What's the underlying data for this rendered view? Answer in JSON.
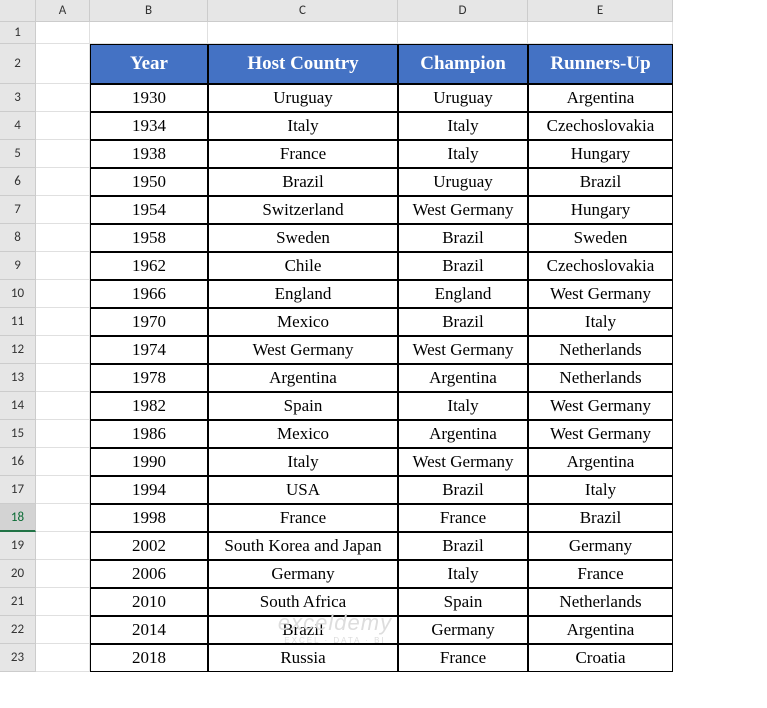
{
  "columns": [
    "A",
    "B",
    "C",
    "D",
    "E"
  ],
  "rowCount": 23,
  "selectedRow": 18,
  "headers": {
    "year": "Year",
    "host": "Host Country",
    "champion": "Champion",
    "runnersup": "Runners-Up"
  },
  "rows": [
    {
      "year": "1930",
      "host": "Uruguay",
      "champion": "Uruguay",
      "runnersup": "Argentina"
    },
    {
      "year": "1934",
      "host": "Italy",
      "champion": "Italy",
      "runnersup": "Czechoslovakia"
    },
    {
      "year": "1938",
      "host": "France",
      "champion": "Italy",
      "runnersup": "Hungary"
    },
    {
      "year": "1950",
      "host": "Brazil",
      "champion": "Uruguay",
      "runnersup": "Brazil"
    },
    {
      "year": "1954",
      "host": "Switzerland",
      "champion": "West Germany",
      "runnersup": "Hungary"
    },
    {
      "year": "1958",
      "host": "Sweden",
      "champion": "Brazil",
      "runnersup": "Sweden"
    },
    {
      "year": "1962",
      "host": "Chile",
      "champion": "Brazil",
      "runnersup": "Czechoslovakia"
    },
    {
      "year": "1966",
      "host": "England",
      "champion": "England",
      "runnersup": "West Germany"
    },
    {
      "year": "1970",
      "host": "Mexico",
      "champion": "Brazil",
      "runnersup": "Italy"
    },
    {
      "year": "1974",
      "host": "West Germany",
      "champion": "West Germany",
      "runnersup": "Netherlands"
    },
    {
      "year": "1978",
      "host": "Argentina",
      "champion": "Argentina",
      "runnersup": "Netherlands"
    },
    {
      "year": "1982",
      "host": "Spain",
      "champion": "Italy",
      "runnersup": "West Germany"
    },
    {
      "year": "1986",
      "host": "Mexico",
      "champion": "Argentina",
      "runnersup": "West Germany"
    },
    {
      "year": "1990",
      "host": "Italy",
      "champion": "West Germany",
      "runnersup": "Argentina"
    },
    {
      "year": "1994",
      "host": "USA",
      "champion": "Brazil",
      "runnersup": "Italy"
    },
    {
      "year": "1998",
      "host": "France",
      "champion": "France",
      "runnersup": "Brazil"
    },
    {
      "year": "2002",
      "host": "South Korea and Japan",
      "champion": "Brazil",
      "runnersup": "Germany"
    },
    {
      "year": "2006",
      "host": "Germany",
      "champion": "Italy",
      "runnersup": "France"
    },
    {
      "year": "2010",
      "host": "South Africa",
      "champion": "Spain",
      "runnersup": "Netherlands"
    },
    {
      "year": "2014",
      "host": "Brazil",
      "champion": "Germany",
      "runnersup": "Argentina"
    },
    {
      "year": "2018",
      "host": "Russia",
      "champion": "France",
      "runnersup": "Croatia"
    }
  ],
  "watermark": {
    "line1": "exceldemy",
    "line2": "EXCEL · DATA · BI"
  }
}
